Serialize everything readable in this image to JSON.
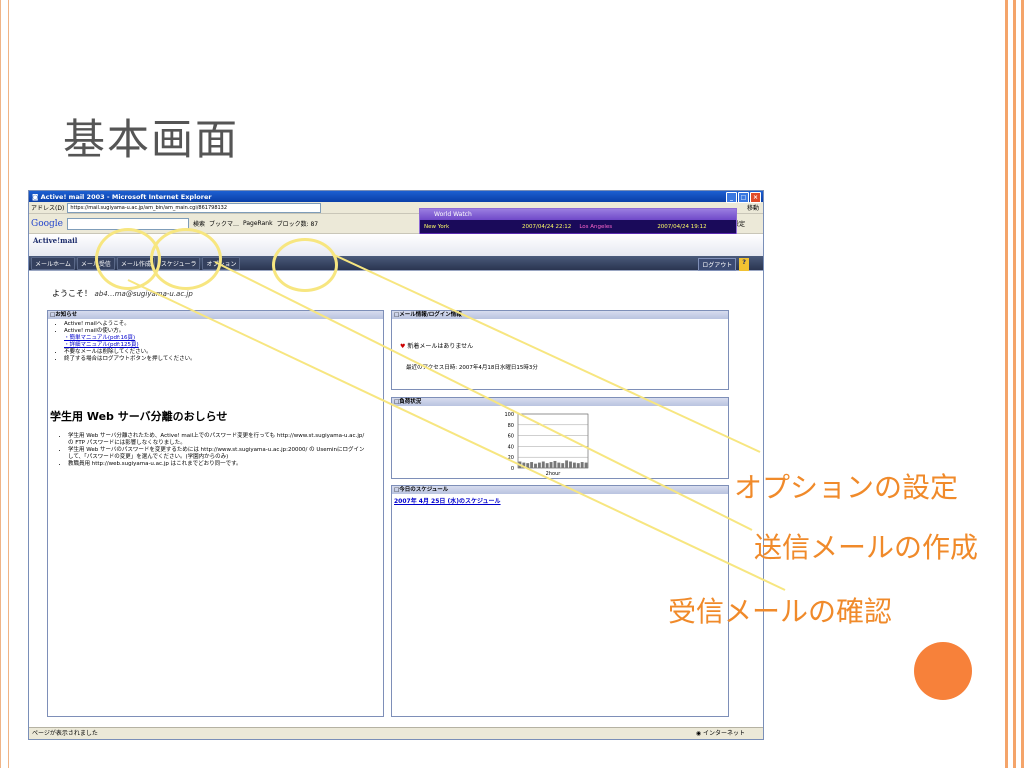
{
  "slide": {
    "title": "基本画面",
    "callouts": {
      "option": "オプションの設定",
      "compose": "送信メールの作成",
      "inbox": "受信メールの確認"
    }
  },
  "browser": {
    "window_title": "Active! mail 2003 - Microsoft Internet Explorer",
    "address_label": "アドレス(D)",
    "address_value": "https://mail.sugiyama-u.ac.jp/am_bin/am_main.cgi/861798132",
    "go_label": "移動",
    "google_label": "Google",
    "search_label": "検索",
    "bookmark_label": "ブックマ…",
    "pagerank_label": "PageRank",
    "blocked_label": "ブロック数: 87",
    "settings_label": "設定",
    "status_text": "ページが表示されました",
    "zone_text": "インターネット"
  },
  "world_watch": {
    "title": "World Watch",
    "city1": "New York",
    "time1": "2007/04/24 22:12",
    "city2": "Los Angeles",
    "time2": "2007/04/24 19:12"
  },
  "app": {
    "logo": "Active!mail",
    "nav": {
      "home": "メールホーム",
      "inbox": "メール受信",
      "compose": "メール作成",
      "schedule": "スケジューラ",
      "option": "オプション"
    },
    "logout": "ログアウト",
    "help": "?",
    "welcome_prefix": "ようこそ！",
    "welcome_user": "ab4…ma@sugiyama-u.ac.jp"
  },
  "notice_panel": {
    "title": "□お知らせ",
    "items": [
      "Active! mailへようこそ。",
      "Active! mailの使い方。",
      "・簡単マニュアル(pdf:16頁)",
      "・詳細マニュアル(pdf:125頁)",
      "不要なメールは削除してください。",
      "終了する場合はログアウトボタンを押してください。"
    ],
    "big_title": "学生用 Web サーバ分離のおしらせ",
    "body": [
      "学生用 Web サーバ分離されたため、Active! mail上でのパスワード変更を行っても http://www.st.sugiyama-u.ac.jp/ の FTP パスワードには影響しなくなりました。",
      "学生用 Web サーバのパスワードを変更するためには http://www.st.sugiyama-u.ac.jp:20000/ の Useminにログインして、「パスワードの変更」を選んでください。(学園内からのみ)",
      "教職員用 http://web.sugiyama-u.ac.jp はこれまでどおり同一です。"
    ]
  },
  "mail_panel": {
    "title": "□メール情報/ログイン情報",
    "no_mail": "新着メールはありません",
    "last_access": "最近のアクセス日時: 2007年4月18日水曜日15時3分"
  },
  "load_panel": {
    "title": "□負荷状況",
    "yaxis": [
      "100",
      "80",
      "60",
      "40",
      "20",
      "0"
    ],
    "bar_values": [
      12,
      10,
      9,
      11,
      8,
      10,
      12,
      9,
      11,
      13,
      10,
      9,
      14,
      12,
      10,
      9,
      11,
      10
    ],
    "x_label": "2hour"
  },
  "schedule_panel": {
    "title": "□今日のスケジュール",
    "link": "2007年 4月 25日 (水)のスケジュール"
  },
  "colors": {
    "callout": "#f08a2a",
    "highlight_circle": "#f7e680",
    "accent": "#f7813a"
  }
}
